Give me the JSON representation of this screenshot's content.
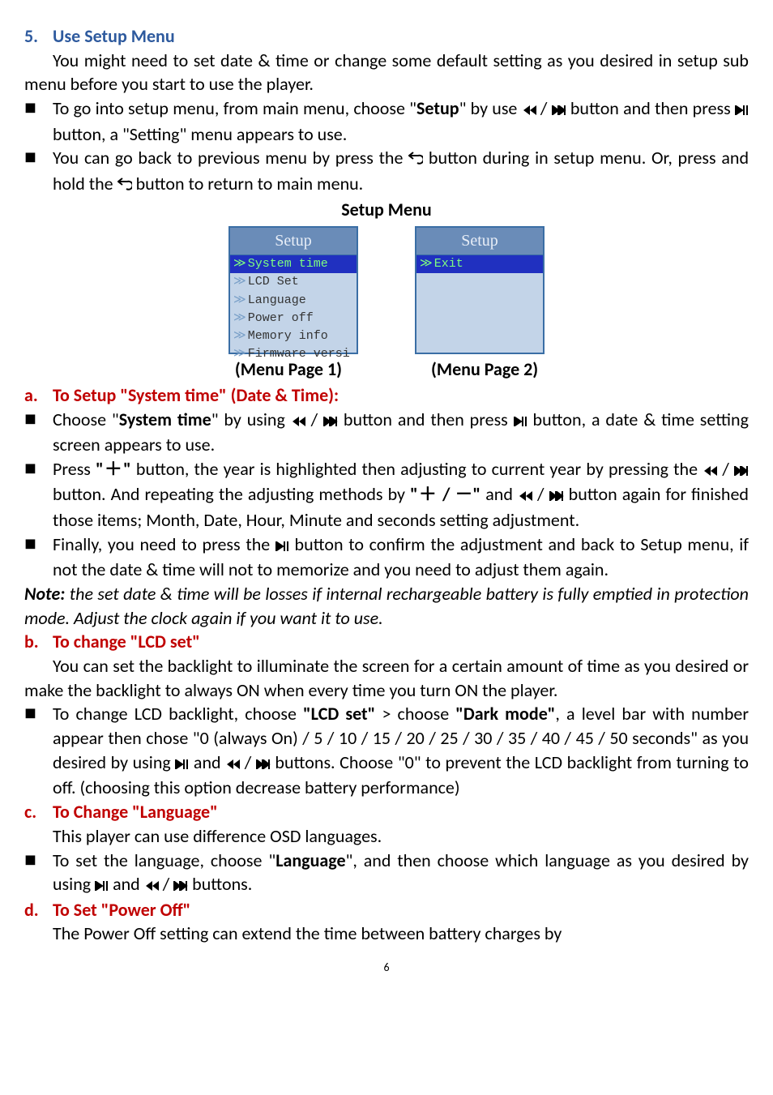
{
  "heading": {
    "num": "5.",
    "text": "Use Setup Menu"
  },
  "intro": "You might need to set date & time or change some default setting as you desired in setup sub menu before you start to use the player.",
  "b1a": "To go into setup menu, from main menu, choose \"",
  "b1b": "Setup",
  "b1c": "\" by use ",
  "b1d": " / ",
  "b1e": " button and then press ",
  "b1f": " button, a \"Setting\" menu appears to use.",
  "b2a": "You can go back to previous menu by press the ",
  "b2b": " button during in setup menu. Or, press and hold the ",
  "b2c": " button to return to main menu.",
  "setupMenuTitle": "Setup Menu",
  "menu": {
    "title": "Setup",
    "items": [
      "System time",
      "LCD Set",
      "Language",
      "Power off",
      "Memory info",
      "Firmware versi"
    ],
    "page2item": "Exit",
    "cap1": "(Menu Page 1)",
    "cap2": "(Menu Page 2)"
  },
  "a": {
    "letter": "a.",
    "title": "To Setup \"System time\" (Date & Time):",
    "b1a": "Choose \"",
    "b1b": "System time",
    "b1c": "\" by using ",
    "b1d": " / ",
    "b1e": " button and then press ",
    "b1f": " button, a date & time setting screen appears to use.",
    "b2a": "Press ",
    "b2b": "\"＋\"",
    "b2c": " button, the year is highlighted then adjusting to current year by pressing the ",
    "b2d": " / ",
    "b2e": " button. And repeating the adjusting methods by ",
    "b2f": "\"＋ / －\"",
    "b2g": " and  ",
    "b2h": " / ",
    "b2i": " button again for finished those items; Month, Date, Hour, Minute and seconds setting adjustment.",
    "b3a": "Finally, you need to press the ",
    "b3b": " button to confirm the adjustment and back to Setup menu, if not the date & time will not to memorize and you need to adjust them again."
  },
  "noteLabel": "Note:",
  "noteText": " the set date & time will be losses if internal rechargeable battery is fully emptied in protection mode. Adjust the clock again if you want it to use.",
  "b": {
    "letter": "b.",
    "title": "To change \"LCD set\"",
    "intro": "You can set the backlight to illuminate the screen for a certain amount of time as you desired or make the backlight to always ON when every time you turn ON the player.",
    "b1a": "To change LCD backlight, choose ",
    "b1b": "\"LCD set\"",
    "b1c": " > choose ",
    "b1d": "\"Dark mode\"",
    "b1e": ", a level bar with number appear then chose \"0 (always On) / 5 / 10 / 15 / 20 / 25 / 30 / 35 / 40 / 45 / 50 seconds\" as you desired by using ",
    "b1f": " and  ",
    "b1g": " / ",
    "b1h": " buttons. Choose \"0\" to prevent the LCD backlight from turning to off. (choosing this option decrease battery performance)"
  },
  "c": {
    "letter": "c.",
    "title": "To Change \"Language\"",
    "intro": "This player can use difference OSD languages.",
    "b1a": "To set the language, choose \"",
    "b1b": "Language",
    "b1c": "\", and then choose which language as you desired by using ",
    "b1d": " and  ",
    "b1e": " / ",
    "b1f": " buttons."
  },
  "d": {
    "letter": "d.",
    "title": "To Set \"Power Off\"",
    "intro": "The Power Off setting can extend the time between battery charges by"
  },
  "pageNumber": "6"
}
